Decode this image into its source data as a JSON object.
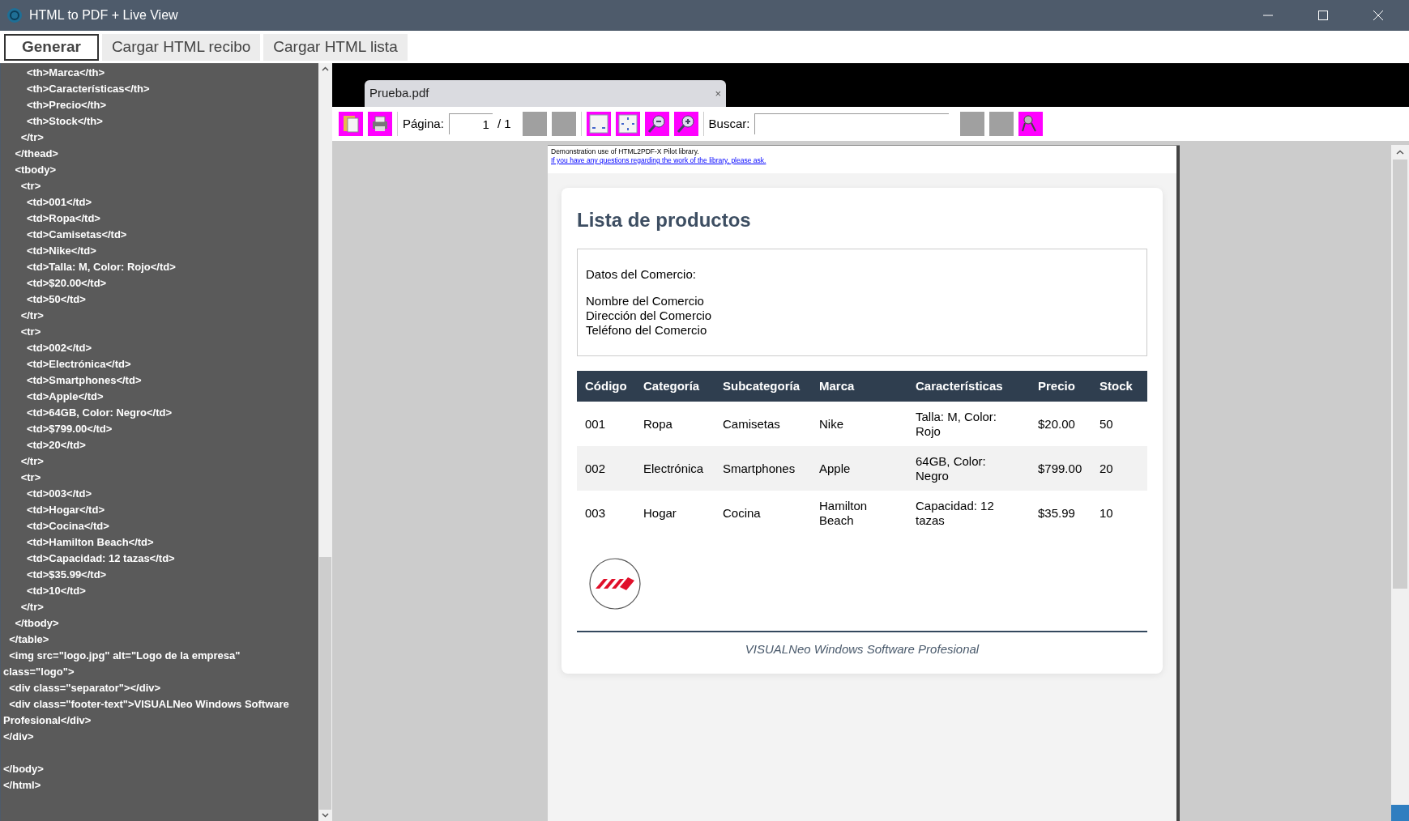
{
  "window": {
    "title": "HTML to PDF + Live View"
  },
  "buttons": [
    {
      "label": "Generar",
      "selected": true
    },
    {
      "label": "Cargar HTML recibo",
      "selected": false
    },
    {
      "label": "Cargar HTML lista",
      "selected": false
    }
  ],
  "code_lines": [
    "        <th>Marca</th>",
    "        <th>Características</th>",
    "        <th>Precio</th>",
    "        <th>Stock</th>",
    "      </tr>",
    "    </thead>",
    "    <tbody>",
    "      <tr>",
    "        <td>001</td>",
    "        <td>Ropa</td>",
    "        <td>Camisetas</td>",
    "        <td>Nike</td>",
    "        <td>Talla: M, Color: Rojo</td>",
    "        <td>$20.00</td>",
    "        <td>50</td>",
    "      </tr>",
    "      <tr>",
    "        <td>002</td>",
    "        <td>Electrónica</td>",
    "        <td>Smartphones</td>",
    "        <td>Apple</td>",
    "        <td>64GB, Color: Negro</td>",
    "        <td>$799.00</td>",
    "        <td>20</td>",
    "      </tr>",
    "      <tr>",
    "        <td>003</td>",
    "        <td>Hogar</td>",
    "        <td>Cocina</td>",
    "        <td>Hamilton Beach</td>",
    "        <td>Capacidad: 12 tazas</td>",
    "        <td>$35.99</td>",
    "        <td>10</td>",
    "      </tr>",
    "    </tbody>",
    "  </table>",
    "  <img src=\"logo.jpg\" alt=\"Logo de la empresa\"",
    "class=\"logo\">",
    "  <div class=\"separator\"></div>",
    "  <div class=\"footer-text\">VISUALNeo Windows Software",
    "Profesional</div>",
    "</div>"
  ],
  "code_tail": [
    "</body>",
    "</html>"
  ],
  "viewer": {
    "tab": {
      "title": "Prueba.pdf",
      "close": "×"
    },
    "toolbar": {
      "page_label": "Página:",
      "page_value": "1",
      "page_total": "/ 1",
      "search_label": "Buscar:"
    },
    "page": {
      "notice": "Demonstration use of HTML2PDF-X Pilot library.",
      "notice_link": "If you have any questions regarding the work of the library, please ask.",
      "heading": "Lista de productos",
      "info_title": "Datos del Comercio:",
      "info_lines": [
        "Nombre del Comercio",
        "Dirección del Comercio",
        "Teléfono del Comercio"
      ],
      "table": {
        "columns": [
          "Código",
          "Categoría",
          "Subcategoría",
          "Marca",
          "Características",
          "Precio",
          "Stock"
        ],
        "rows": [
          [
            "001",
            "Ropa",
            "Camisetas",
            "Nike",
            "Talla: M, Color: Rojo",
            "$20.00",
            "50"
          ],
          [
            "002",
            "Electrónica",
            "Smartphones",
            "Apple",
            "64GB, Color: Negro",
            "$799.00",
            "20"
          ],
          [
            "003",
            "Hogar",
            "Cocina",
            "Hamilton Beach",
            "Capacidad: 12 tazas",
            "$35.99",
            "10"
          ]
        ]
      },
      "footer": "VISUALNeo Windows Software Profesional"
    }
  }
}
